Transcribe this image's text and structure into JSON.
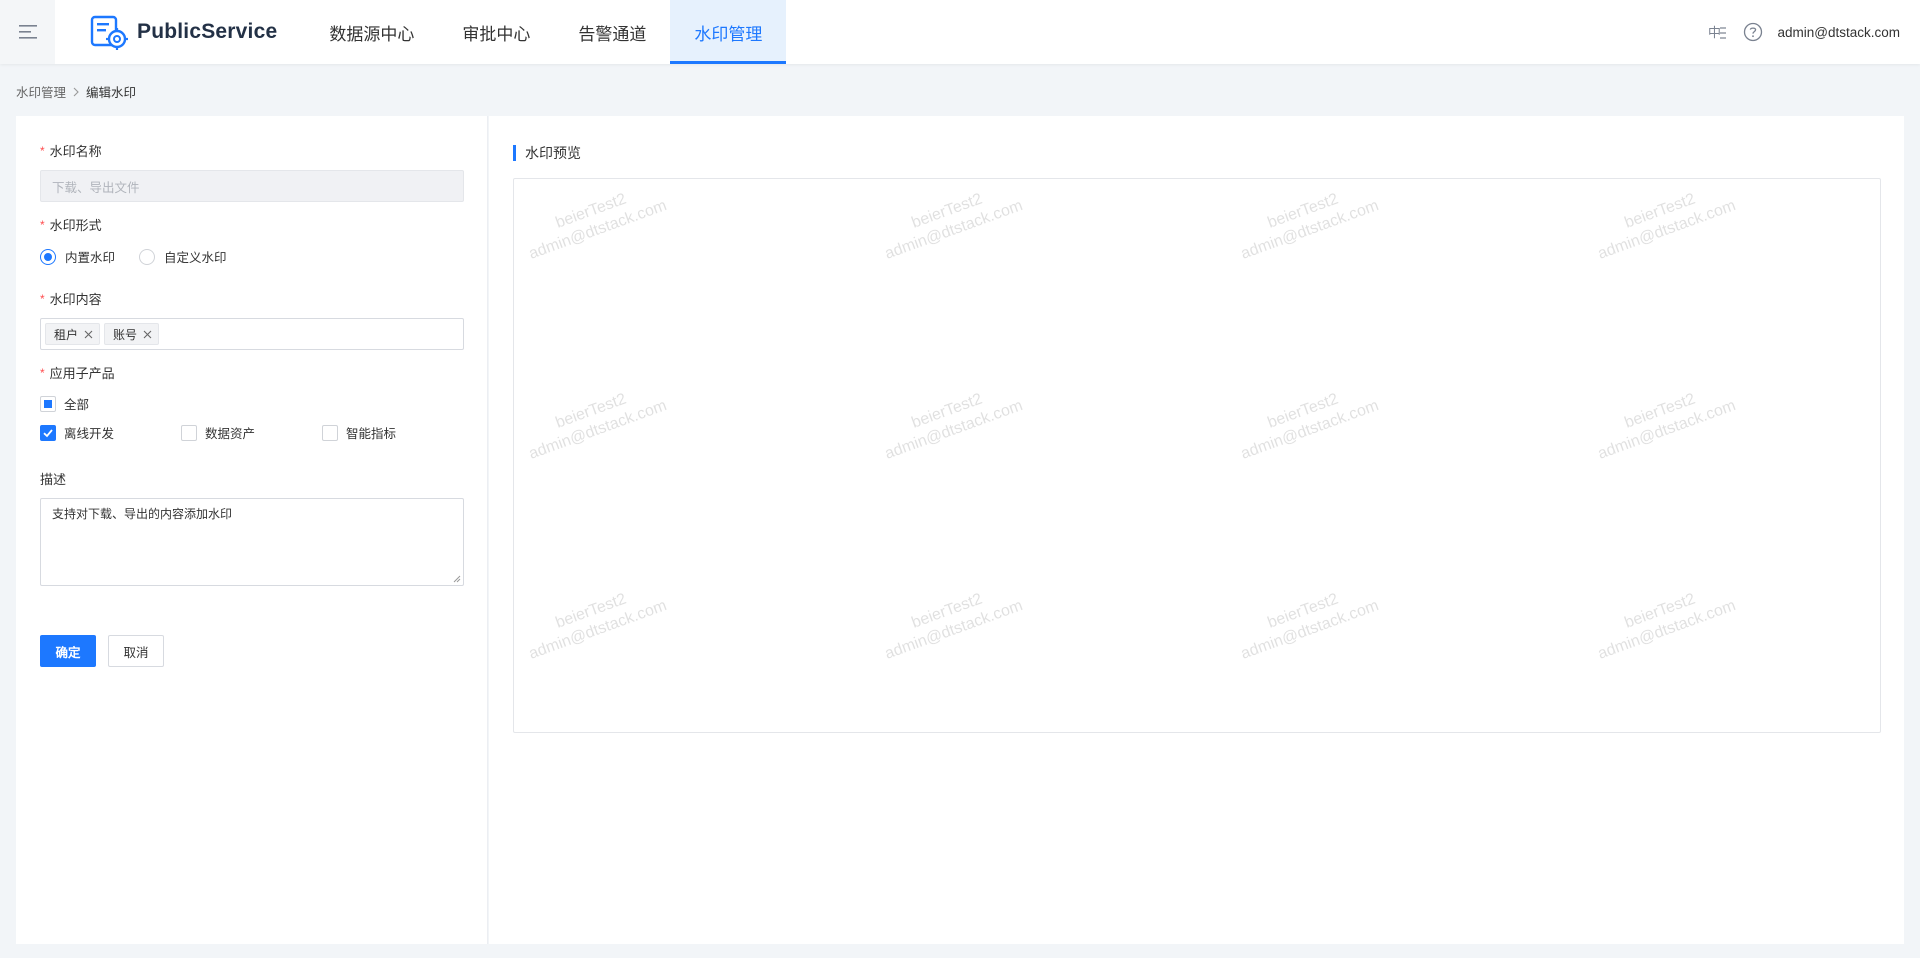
{
  "header": {
    "brand": "PublicService",
    "nav": [
      "数据源中心",
      "审批中心",
      "告警通道",
      "水印管理"
    ],
    "active_index": 3,
    "user": "admin@dtstack.com",
    "icons": [
      "menu-icon",
      "language-icon",
      "help-icon"
    ]
  },
  "breadcrumb": {
    "parent": "水印管理",
    "current": "编辑水印"
  },
  "form": {
    "name": {
      "label": "水印名称",
      "placeholder": "下载、导出文件"
    },
    "form_type": {
      "label": "水印形式",
      "options": [
        "内置水印",
        "自定义水印"
      ],
      "selected": "内置水印"
    },
    "content": {
      "label": "水印内容",
      "tags": [
        "租户",
        "账号"
      ]
    },
    "products": {
      "label": "应用子产品",
      "all_label": "全部",
      "all_state": "indeterminate",
      "items": [
        {
          "label": "离线开发",
          "checked": true
        },
        {
          "label": "数据资产",
          "checked": false
        },
        {
          "label": "智能指标",
          "checked": false
        }
      ]
    },
    "description": {
      "label": "描述",
      "value": "支持对下载、导出的内容添加水印"
    },
    "confirm": "确定",
    "cancel": "取消"
  },
  "preview": {
    "title": "水印预览",
    "watermark_line1": "beierTest2",
    "watermark_line2": "admin@dtstack.com"
  },
  "colors": {
    "primary": "#1d78ff",
    "required": "#ff4d4f"
  }
}
